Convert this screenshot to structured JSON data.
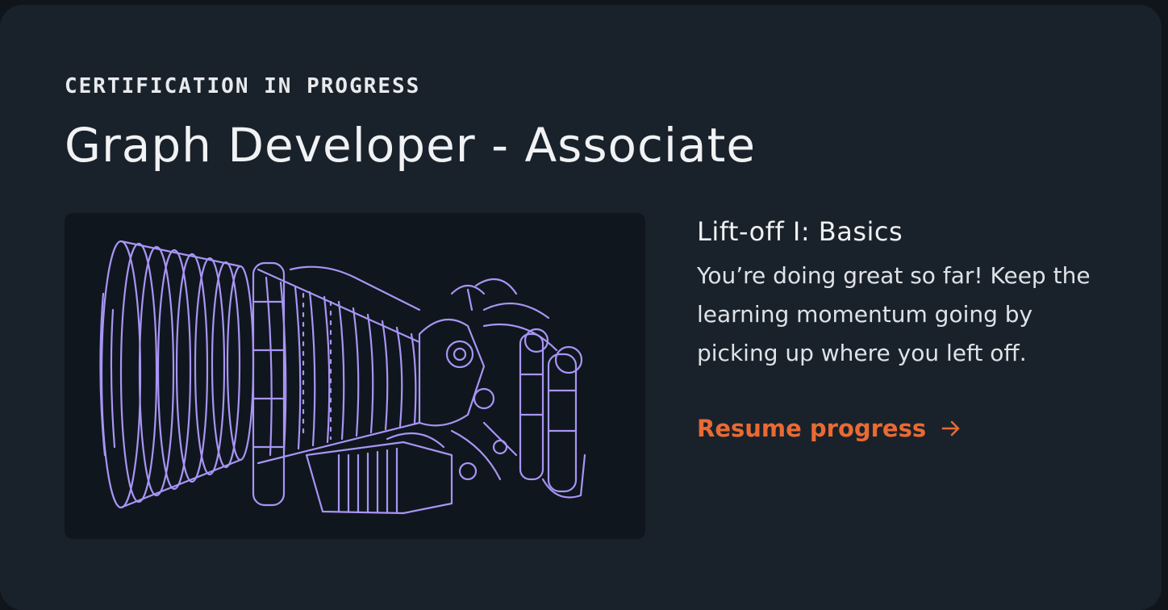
{
  "certification": {
    "eyebrow": "CERTIFICATION IN PROGRESS",
    "title": "Graph Developer - Associate"
  },
  "course": {
    "title": "Lift-off I: Basics",
    "description": "You’re doing great so far! Keep the learning momentum going by picking up where you left off."
  },
  "action": {
    "label": "Resume progress",
    "icon": "arrow-right-icon"
  },
  "illustration": {
    "icon": "rocket-engine-illustration"
  },
  "colors": {
    "card_background": "#19222b",
    "illustration_background": "#10161d",
    "illustration_stroke": "#a795f5",
    "accent": "#ea6a33",
    "text": "#f1f2f4"
  }
}
